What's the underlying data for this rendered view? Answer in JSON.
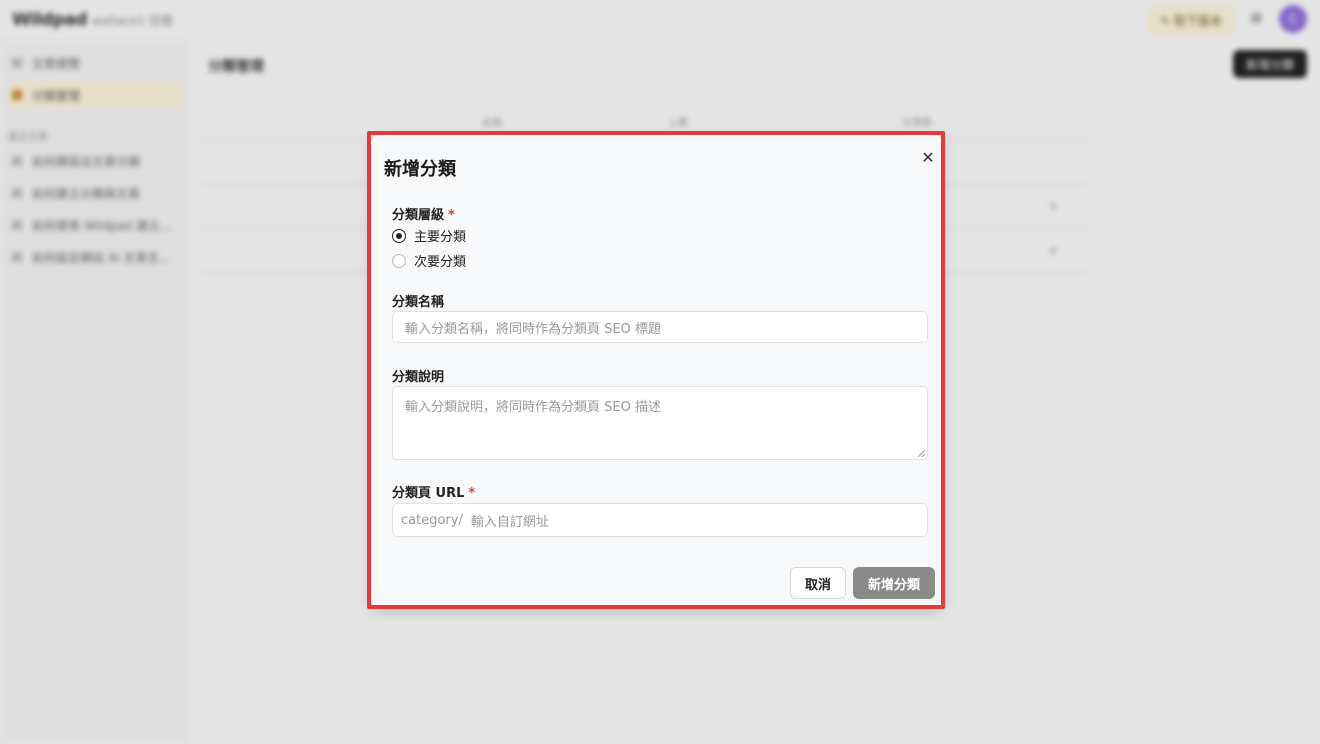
{
  "background": {
    "logo": "Wildpad",
    "workspace": "wallace1 空間",
    "upgrade_label": "✎ 取下版本",
    "avatar_initial": "C",
    "sidebar": {
      "items": [
        {
          "label": "文章總覽"
        },
        {
          "label": "分類管理"
        }
      ],
      "section_label": "最近文章",
      "recent": [
        {
          "label": "如何撰寫出文章分類"
        },
        {
          "label": "如何建立分類與文章"
        },
        {
          "label": "如何使用 Wildpad 建立..."
        },
        {
          "label": "如何設定網站 AI 文章生..."
        }
      ]
    },
    "main": {
      "title": "分類管理",
      "new_button": "新增分類",
      "columns": [
        "名稱",
        "上層",
        "文章數"
      ],
      "rows": [
        {
          "value": "0"
        },
        {
          "value": "0"
        }
      ]
    }
  },
  "modal": {
    "title": "新增分類",
    "level": {
      "label": "分類層級",
      "required": "*",
      "options": [
        {
          "label": "主要分類",
          "checked": true
        },
        {
          "label": "次要分類",
          "checked": false
        }
      ]
    },
    "name": {
      "label": "分類名稱",
      "placeholder": "輸入分類名稱，將同時作為分類頁 SEO 標題"
    },
    "description": {
      "label": "分類說明",
      "placeholder": "輸入分類說明，將同時作為分類頁 SEO 描述"
    },
    "url": {
      "label": "分類頁 URL",
      "required": "*",
      "prefix": "category/",
      "placeholder": "輸入自訂網址"
    },
    "cancel_label": "取消",
    "submit_label": "新增分類"
  },
  "colors": {
    "highlight": "#e03c3c",
    "submit_disabled": "#8a8a8a",
    "active_nav": "#f6ecd4"
  },
  "icons": {
    "close": "close-icon",
    "radio_checked": "radio-checked-icon"
  }
}
